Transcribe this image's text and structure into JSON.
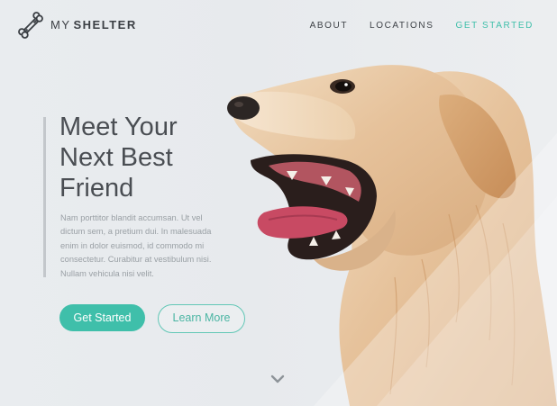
{
  "brand": {
    "light": "MY",
    "bold": "SHELTER",
    "logo_icon": "bone-icon"
  },
  "nav": {
    "items": [
      {
        "label": "ABOUT"
      },
      {
        "label": "LOCATIONS"
      },
      {
        "label": "GET STARTED"
      }
    ]
  },
  "hero": {
    "headline_lines": [
      "Meet Your",
      "Next Best",
      "Friend"
    ],
    "body_lines": [
      "Nam porttitor blandit accumsan. Ut vel",
      "dictum sem, a pretium dui. In malesuada",
      "enim in dolor euismod, id commodo mi",
      "consectetur. Curabitur at vestibulum nisi.",
      "Nullam vehicula nisi velit."
    ],
    "primary_button": "Get Started",
    "secondary_button": "Learn More"
  },
  "colors": {
    "accent": "#3fbfaa",
    "text_dark": "#4a4e53",
    "text_muted": "#9aa0a5",
    "background": "#e9ecef"
  },
  "icons": {
    "scroll": "chevron-down-icon"
  }
}
